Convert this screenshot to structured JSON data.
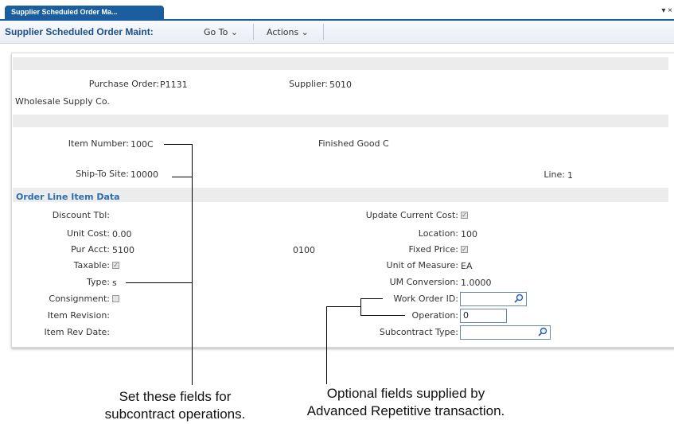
{
  "tab": {
    "title": "Supplier Scheduled Order Ma...",
    "controls": "▾ ×"
  },
  "toolbar": {
    "title": "Supplier Scheduled Order Maint:",
    "goto": "Go To ⌄",
    "actions": "Actions ⌄"
  },
  "header": {
    "po_label": "Purchase Order:",
    "po_value": "P1131",
    "supplier_label": "Supplier:",
    "supplier_value": "5010",
    "supplier_name": "Wholesale Supply Co."
  },
  "item": {
    "item_label": "Item Number:",
    "item_value": "100C",
    "item_desc": "Finished Good C",
    "site_label": "Ship-To Site:",
    "site_value": "10000",
    "line_label": "Line:",
    "line_value": "1"
  },
  "section_title": "Order Line Item Data",
  "left_fields": {
    "discount_label": "Discount Tbl:",
    "unit_cost_label": "Unit Cost:",
    "unit_cost_value": "0.00",
    "pur_acct_label": "Pur Acct:",
    "pur_acct_value": "5100",
    "pur_acct_sub": "0100",
    "taxable_label": "Taxable:",
    "type_label": "Type:",
    "type_value": "s",
    "consignment_label": "Consignment:",
    "item_rev_label": "Item Revision:",
    "item_rev_date_label": "Item Rev Date:"
  },
  "right_fields": {
    "update_cost_label": "Update Current Cost:",
    "location_label": "Location:",
    "location_value": "100",
    "fixed_price_label": "Fixed Price:",
    "uom_label": "Unit of Measure:",
    "uom_value": "EA",
    "um_conv_label": "UM Conversion:",
    "um_conv_value": "1.0000",
    "work_order_label": "Work Order ID:",
    "work_order_value": "",
    "operation_label": "Operation:",
    "operation_value": "0",
    "subcontract_label": "Subcontract Type:",
    "subcontract_value": ""
  },
  "callouts": {
    "left_line1": "Set these fields for",
    "left_line2": "subcontract operations.",
    "right_line1": "Optional fields supplied by",
    "right_line2": "Advanced Repetitive transaction."
  },
  "colors": {
    "brand": "#1b5e9f",
    "section": "#2a6db4"
  },
  "icons": {
    "lookup": "magnifier-icon",
    "check": "checkmark-icon"
  }
}
